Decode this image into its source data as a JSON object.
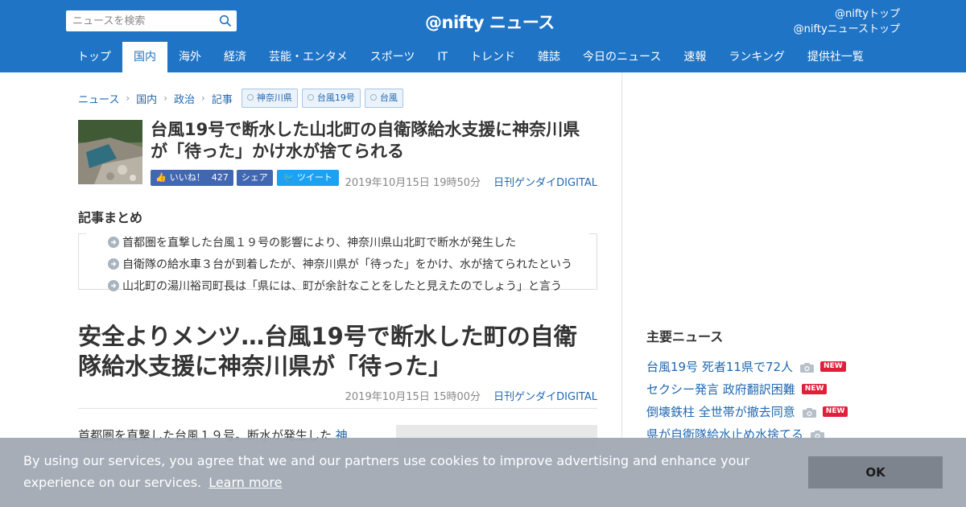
{
  "header": {
    "search_placeholder": "ニュースを検索",
    "logo": "@nifty ニュース",
    "top_links": [
      "@niftyトップ",
      "@niftyニューストップ"
    ],
    "nav": [
      {
        "label": "トップ",
        "active": false
      },
      {
        "label": "国内",
        "active": true
      },
      {
        "label": "海外",
        "active": false
      },
      {
        "label": "経済",
        "active": false
      },
      {
        "label": "芸能・エンタメ",
        "active": false
      },
      {
        "label": "スポーツ",
        "active": false
      },
      {
        "label": "IT",
        "active": false
      },
      {
        "label": "トレンド",
        "active": false
      },
      {
        "label": "雑誌",
        "active": false
      },
      {
        "label": "今日のニュース",
        "active": false
      },
      {
        "label": "速報",
        "active": false
      },
      {
        "label": "ランキング",
        "active": false
      },
      {
        "label": "提供社一覧",
        "active": false
      }
    ],
    "colors": {
      "brand": "#1f74c6"
    }
  },
  "breadcrumb": [
    "ニュース",
    "国内",
    "政治",
    "記事"
  ],
  "tags": [
    "神奈川県",
    "台風19号",
    "台風"
  ],
  "article": {
    "headline": "台風19号で断水した山北町の自衛隊給水支援に神奈川県が「待った」かけ水が捨てられる",
    "like_label": "いいね！",
    "like_count": "427",
    "share_label": "シェア",
    "tweet_label": "ツイート",
    "date": "2019年10月15日 19時50分",
    "source": "日刊ゲンダイDIGITAL",
    "summary_title": "記事まとめ",
    "summary": [
      "首都圏を直撃した台風１９号の影響により、神奈川県山北町で断水が発生した",
      "自衛隊の給水車３台が到着したが、神奈川県が「待った」をかけ、水が捨てられたという",
      "山北町の湯川裕司町長は「県には、町が余計なことをしたと見えたのでしょう」と言う"
    ],
    "title2": "安全よりメンツ…台風19号で断水した町の自衛隊給水支援に神奈川県が「待った」",
    "date2": "2019年10月15日 15時00分",
    "source2": "日刊ゲンダイDIGITAL",
    "body_text": "首都圏を直撃した台風１９号。断水が発生した",
    "body_link": "神"
  },
  "side": {
    "title": "主要ニュース",
    "items": [
      {
        "text": "台風19号 死者11県で72人",
        "camera": true,
        "new": true
      },
      {
        "text": "セクシー発言 政府翻訳困難",
        "camera": false,
        "new": true
      },
      {
        "text": "倒壊鉄柱 全世帯が撤去同意",
        "camera": true,
        "new": true
      },
      {
        "text": "県が自衛隊給水止め水捨てる",
        "camera": true,
        "new": false
      }
    ],
    "new_label": "NEW"
  },
  "cookie": {
    "message": "By using our services, you agree that we and our partners use cookies to improve advertising and enhance your experience on our services.",
    "learn_more": "Learn more",
    "ok": "OK"
  }
}
